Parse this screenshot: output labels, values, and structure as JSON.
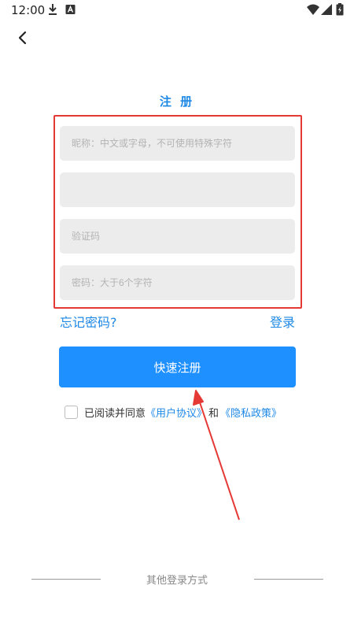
{
  "status_bar": {
    "time": "12:00"
  },
  "header": {
    "title": "注 册"
  },
  "form": {
    "nickname_placeholder": "昵称：中文或字母，不可使用特殊字符",
    "second_field_value": "",
    "code_placeholder": "验证码",
    "password_placeholder": "密码：大于6个字符"
  },
  "links": {
    "forgot_password": "忘记密码?",
    "login": "登录"
  },
  "register_button": "快速注册",
  "agreement": {
    "prefix": "已阅读并同意",
    "user_agreement": "《用户协议》",
    "and": "和",
    "privacy_policy": "《隐私政策》"
  },
  "other_login": "其他登录方式",
  "colors": {
    "accent": "#1e88e5",
    "button": "#1e90ff",
    "highlight": "#e53935",
    "field_bg": "#ececec"
  },
  "icons": {
    "download": "download-icon",
    "notification": "a-notification-icon",
    "wifi": "wifi-icon",
    "signal": "signal-icon",
    "battery": "battery-charging-icon",
    "back": "back-arrow-icon"
  }
}
